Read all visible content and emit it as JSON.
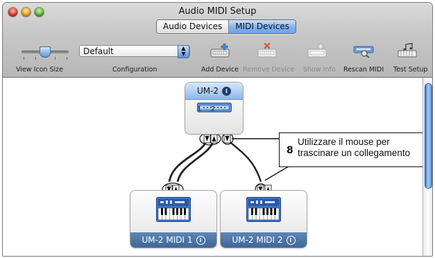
{
  "window": {
    "title": "Audio MIDI Setup",
    "tabs": [
      {
        "label": "Audio Devices",
        "selected": false
      },
      {
        "label": "MIDI Devices",
        "selected": true
      }
    ]
  },
  "toolbar": {
    "view_icon_size_label": "View Icon Size",
    "configuration": {
      "value": "Default",
      "label": "Configuration"
    },
    "buttons": [
      {
        "label": "Add Device",
        "enabled": true,
        "icon": "add-device-icon"
      },
      {
        "label": "Remove Device",
        "enabled": false,
        "icon": "remove-device-icon"
      },
      {
        "label": "Show Info",
        "enabled": false,
        "icon": "show-info-icon"
      },
      {
        "label": "Rescan MIDI",
        "enabled": true,
        "icon": "rescan-midi-icon"
      },
      {
        "label": "Test Setup",
        "enabled": true,
        "icon": "test-setup-icon"
      }
    ]
  },
  "devices": {
    "interface": {
      "name": "UM-2",
      "ports": [
        "1",
        "2"
      ]
    },
    "keyboard1": {
      "name": "UM-2 MIDI 1"
    },
    "keyboard2": {
      "name": "UM-2 MIDI 2"
    }
  },
  "info_glyph": "i",
  "callout": {
    "number": "8",
    "text": "Utilizzare il mouse per trascinare un collegamento"
  },
  "colors": {
    "selected_tab": "#86b5ee",
    "device_footer": "#4a72a4",
    "scroll_thumb": "#5d94dd"
  }
}
